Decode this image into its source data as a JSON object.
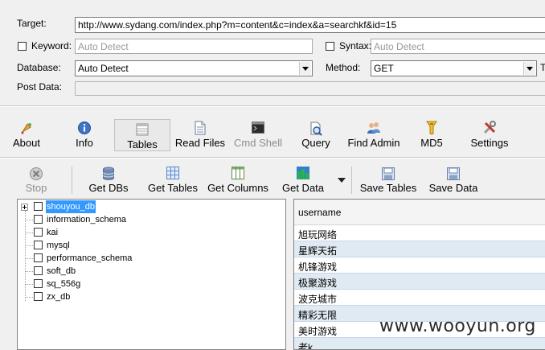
{
  "form": {
    "target_label": "Target:",
    "target_value": "http://www.sydang.com/index.php?m=content&c=index&a=searchkf&id=15",
    "keyword_label": "Keyword:",
    "keyword_placeholder": "Auto Detect",
    "syntax_label": "Syntax:",
    "syntax_placeholder": "Auto Detect",
    "database_label": "Database:",
    "database_value": "Auto Detect",
    "method_label": "Method:",
    "method_value": "GET",
    "postdata_label": "Post Data:",
    "extra_char": "T"
  },
  "main_toolbar": {
    "about": "About",
    "info": "Info",
    "tables": "Tables",
    "read_files": "Read Files",
    "cmd_shell": "Cmd Shell",
    "query": "Query",
    "find_admin": "Find Admin",
    "md5": "MD5",
    "settings": "Settings"
  },
  "sub_toolbar": {
    "stop": "Stop",
    "get_dbs": "Get DBs",
    "get_tables": "Get Tables",
    "get_columns": "Get Columns",
    "get_data": "Get Data",
    "save_tables": "Save Tables",
    "save_data": "Save Data"
  },
  "tree": {
    "items": [
      "shouyou_db",
      "information_schema",
      "kai",
      "mysql",
      "performance_schema",
      "soft_db",
      "sq_556g",
      "zx_db"
    ]
  },
  "grid": {
    "column": "username",
    "rows": [
      "旭玩网络",
      "星辉天拓",
      "机锋游戏",
      "极聚游戏",
      "波克城市",
      "精彩无限",
      "美时游戏",
      "老k"
    ]
  },
  "watermark": "www.wooyun.org",
  "colors": {
    "window_bg": "#f0f0f0",
    "selection": "#3399ff",
    "alt_row": "#dfeaf2"
  }
}
